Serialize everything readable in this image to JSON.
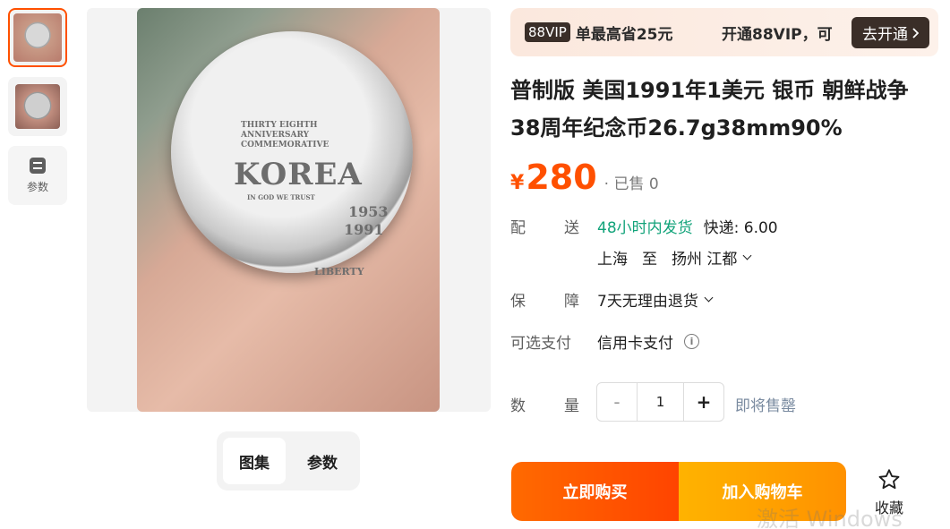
{
  "thumbnails": {
    "params_label": "参数"
  },
  "coin": {
    "anniversary": "THIRTY EIGHTH ANNIVERSARY COMMEMORATIVE",
    "korea": "KOREA",
    "trust": "IN GOD WE TRUST",
    "year1": "1953",
    "year2": "1991",
    "liberty": "LIBERTY"
  },
  "gallery_tabs": [
    {
      "label": "图集",
      "active": true
    },
    {
      "label": "参数",
      "active": false
    }
  ],
  "vip": {
    "badge": "88VIP",
    "save_text": "单最高省25元",
    "open_text": "开通88VIP，可",
    "button_label": "去开通"
  },
  "product": {
    "title": "普制版 美国1991年1美元 银币 朝鲜战争38周年纪念币26.7g38mm90%",
    "currency": "¥",
    "price": "280",
    "sold": "· 已售 0"
  },
  "shipping": {
    "label_a": "配",
    "label_b": "送",
    "ship_time": "48小时内发货",
    "express": "快递: 6.00",
    "from": "上海",
    "to_word": "至",
    "destination": "扬州 江都"
  },
  "guarantee": {
    "label_a": "保",
    "label_b": "障",
    "value": "7天无理由退货"
  },
  "payment": {
    "label": "可选支付",
    "value": "信用卡支付",
    "info_icon": "ⓘ"
  },
  "quantity": {
    "label_a": "数",
    "label_b": "量",
    "minus": "-",
    "value": "1",
    "plus": "+",
    "status": "即将售罄"
  },
  "actions": {
    "buy_now": "立即购买",
    "add_cart": "加入购物车",
    "favorite": "收藏"
  },
  "watermark": "激活 Windows",
  "colors": {
    "accent": "#ff5000",
    "green": "#12a37a",
    "vip_dark": "#3a2e28"
  }
}
